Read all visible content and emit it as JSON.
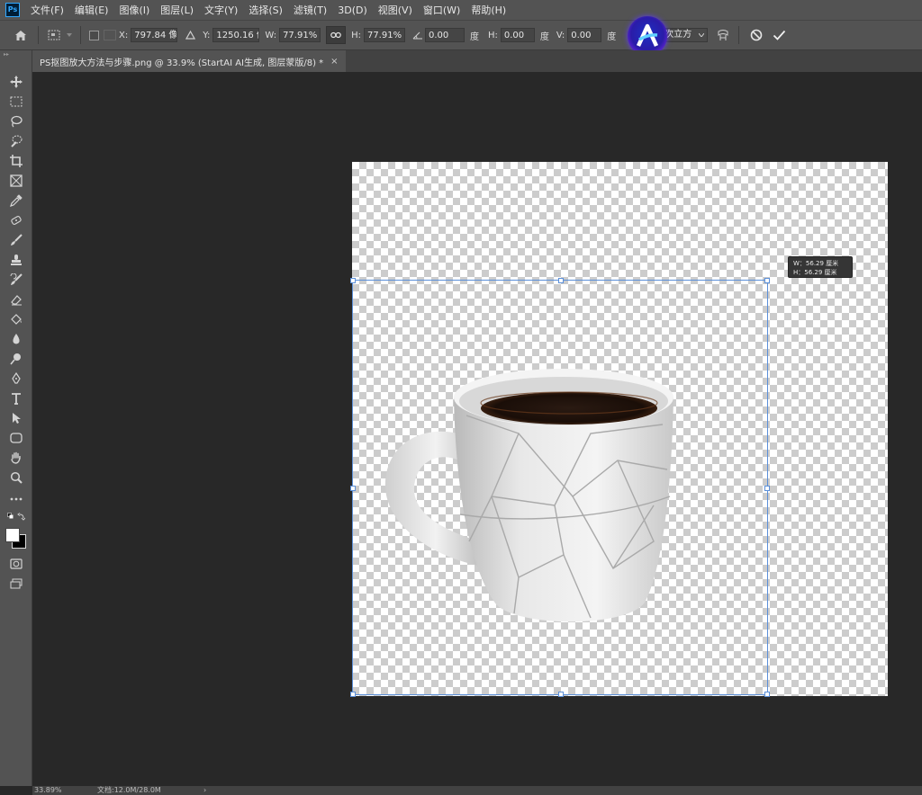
{
  "app": {
    "logo_text": "Ps"
  },
  "menu": [
    {
      "label": "文件(F)"
    },
    {
      "label": "编辑(E)"
    },
    {
      "label": "图像(I)"
    },
    {
      "label": "图层(L)"
    },
    {
      "label": "文字(Y)"
    },
    {
      "label": "选择(S)"
    },
    {
      "label": "滤镜(T)"
    },
    {
      "label": "3D(D)"
    },
    {
      "label": "视图(V)"
    },
    {
      "label": "窗口(W)"
    },
    {
      "label": "帮助(H)"
    }
  ],
  "options": {
    "x_label": "X:",
    "x_value": "797.84 像素",
    "y_label": "Y:",
    "y_value": "1250.16 像",
    "w_label": "W:",
    "w_value": "77.91%",
    "h_label": "H:",
    "h_value": "77.91%",
    "angle_value": "0.00",
    "angle_unit": "度",
    "hskew_label": "H:",
    "hskew_value": "0.00",
    "hskew_unit": "度",
    "vskew_label": "V:",
    "vskew_value": "0.00",
    "vskew_unit": "度",
    "interpolation": "两次立方"
  },
  "document": {
    "tab_title": "PS抠图放大方法与步骤.png @ 33.9% (StartAI AI生成, 图层蒙版/8) *",
    "close_glyph": "×"
  },
  "tooltip": {
    "w_line": "W：56.29 厘米",
    "h_line": "H：56.29 厘米"
  },
  "status": {
    "zoom": "33.89%",
    "doc_info": "文档:12.0M/28.0M",
    "arrow": "›"
  },
  "colors": {
    "ui_panel": "#535353",
    "canvas_bg": "#282828",
    "transform_border": "#5b8fd8",
    "accent": "#31a8ff"
  }
}
